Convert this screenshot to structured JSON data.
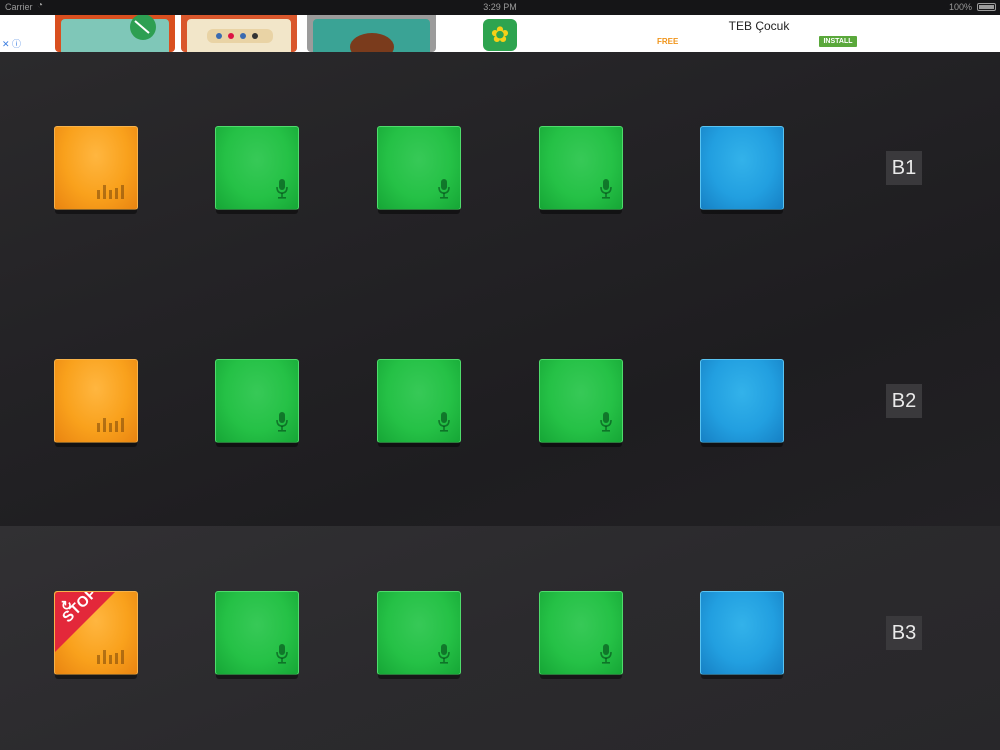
{
  "status_bar": {
    "carrier": "Carrier",
    "time": "3:29 PM",
    "battery": "100%"
  },
  "ad": {
    "app_name": "TEB Çocuk",
    "price": "FREE",
    "install_label": "INSTALL"
  },
  "rows": [
    {
      "label": "B1",
      "pads": [
        {
          "color": "orange",
          "icon": "equalizer-icon"
        },
        {
          "color": "green",
          "icon": "microphone-icon"
        },
        {
          "color": "green",
          "icon": "microphone-icon"
        },
        {
          "color": "green",
          "icon": "microphone-icon"
        },
        {
          "color": "blue",
          "icon": ""
        }
      ]
    },
    {
      "label": "B2",
      "pads": [
        {
          "color": "orange",
          "icon": "equalizer-icon"
        },
        {
          "color": "green",
          "icon": "microphone-icon"
        },
        {
          "color": "green",
          "icon": "microphone-icon"
        },
        {
          "color": "green",
          "icon": "microphone-icon"
        },
        {
          "color": "blue",
          "icon": ""
        }
      ]
    },
    {
      "label": "B3",
      "pads": [
        {
          "color": "orange",
          "icon": "equalizer-icon",
          "badge": "STOP"
        },
        {
          "color": "green",
          "icon": "microphone-icon"
        },
        {
          "color": "green",
          "icon": "microphone-icon"
        },
        {
          "color": "green",
          "icon": "microphone-icon"
        },
        {
          "color": "blue",
          "icon": ""
        }
      ]
    }
  ],
  "colors": {
    "orange": "#f9a11c",
    "green": "#25c146",
    "blue": "#229fe0",
    "stop_red": "#e3283a"
  }
}
